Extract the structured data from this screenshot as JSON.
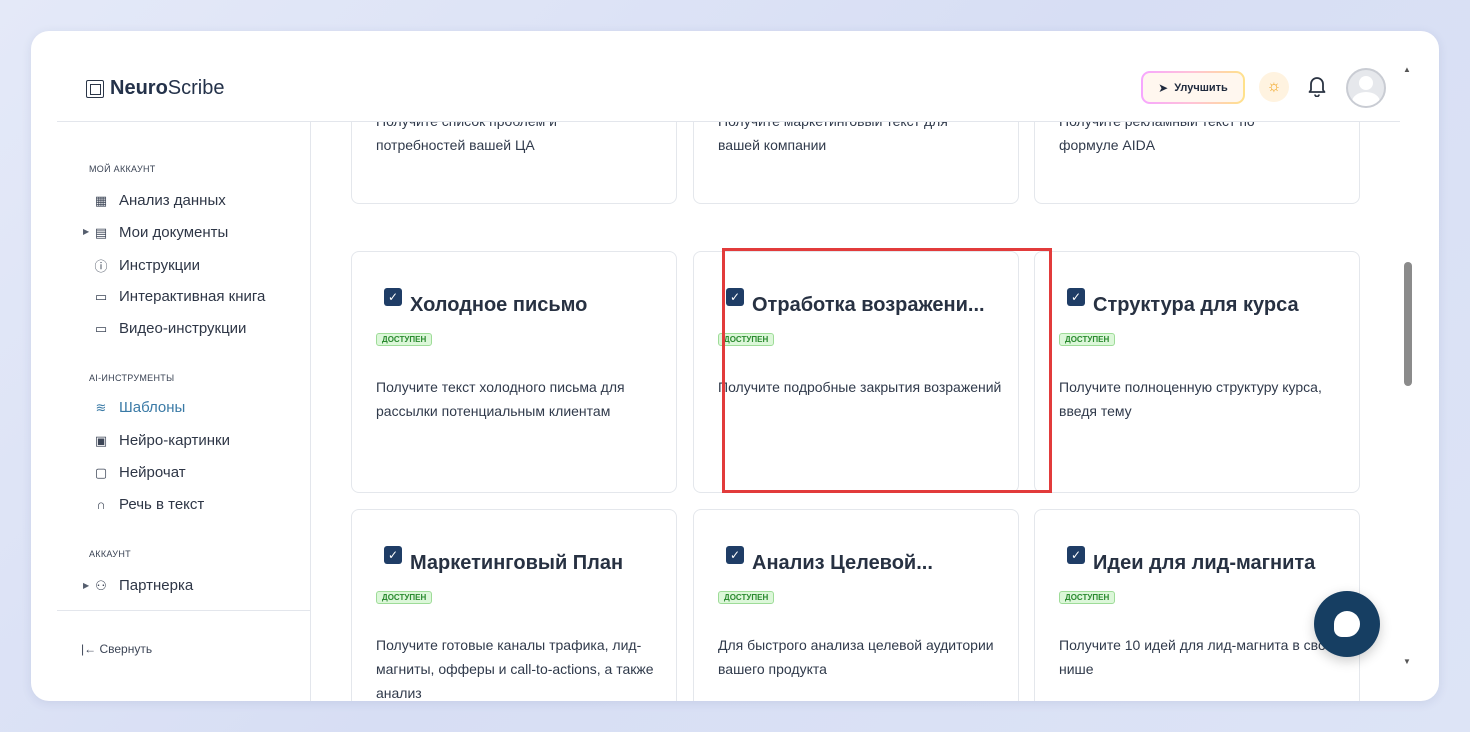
{
  "header": {
    "logo_bold": "Neuro",
    "logo_regular": "Scribe",
    "upgrade_label": "Улучшить"
  },
  "sidebar": {
    "sections": [
      {
        "title": "МОЙ АККАУНТ",
        "items": [
          {
            "label": "Анализ данных",
            "icon": "grid-icon"
          },
          {
            "label": "Мои документы",
            "icon": "document-icon"
          },
          {
            "label": "Инструкции",
            "icon": "question-icon"
          },
          {
            "label": "Интерактивная книга",
            "icon": "book-icon"
          },
          {
            "label": "Видео-инструкции",
            "icon": "video-icon"
          }
        ]
      },
      {
        "title": "AI-ИНСТРУМЕНТЫ",
        "items": [
          {
            "label": "Шаблоны",
            "icon": "layers-icon",
            "active": true
          },
          {
            "label": "Нейро-картинки",
            "icon": "image-icon"
          },
          {
            "label": "Нейрочат",
            "icon": "chat-icon"
          },
          {
            "label": "Речь в текст",
            "icon": "headphones-icon"
          }
        ]
      },
      {
        "title": "АККАУНТ",
        "items": [
          {
            "label": "Партнерка",
            "icon": "users-icon"
          }
        ]
      }
    ],
    "collapse_label": "Свернуть"
  },
  "cards": {
    "top_row": [
      {
        "desc_prefix": "Получите список проблем и",
        "desc": "потребностей вашей ЦА"
      },
      {
        "desc_prefix": "Получите маркетинговый текст для",
        "desc": "вашей компании"
      },
      {
        "desc_prefix": "Получите рекламный текст по",
        "desc": "формуле AIDA"
      }
    ],
    "middle_row": [
      {
        "title": "Холодное письмо",
        "badge": "ДОСТУПЕН",
        "desc": "Получите текст холодного письма для рассылки потенциальным клиентам"
      },
      {
        "title": "Отработка возражени...",
        "badge": "ДОСТУПЕН",
        "desc": "Получите подробные закрытия возражений"
      },
      {
        "title": "Структура для курса",
        "badge": "ДОСТУПЕН",
        "desc": "Получите полноценную структуру курса, введя тему"
      }
    ],
    "bottom_row": [
      {
        "title": "Маркетинговый План",
        "badge": "ДОСТУПЕН",
        "desc": "Получите готовые каналы трафика, лид-магниты, офферы и call-to-actions, а также анализ"
      },
      {
        "title": "Анализ Целевой...",
        "badge": "ДОСТУПЕН",
        "desc": "Для быстрого анализа целевой аудитории вашего продукта"
      },
      {
        "title": "Идеи для лид-магнита",
        "badge": "ДОСТУПЕН",
        "desc": "Получите 10 идей для лид-магнита в своей нише"
      }
    ]
  },
  "colors": {
    "accent": "#3a7aa6",
    "highlight": "#e23b3b",
    "badge_bg": "#dcf7d9",
    "chat_button": "#163e62"
  }
}
